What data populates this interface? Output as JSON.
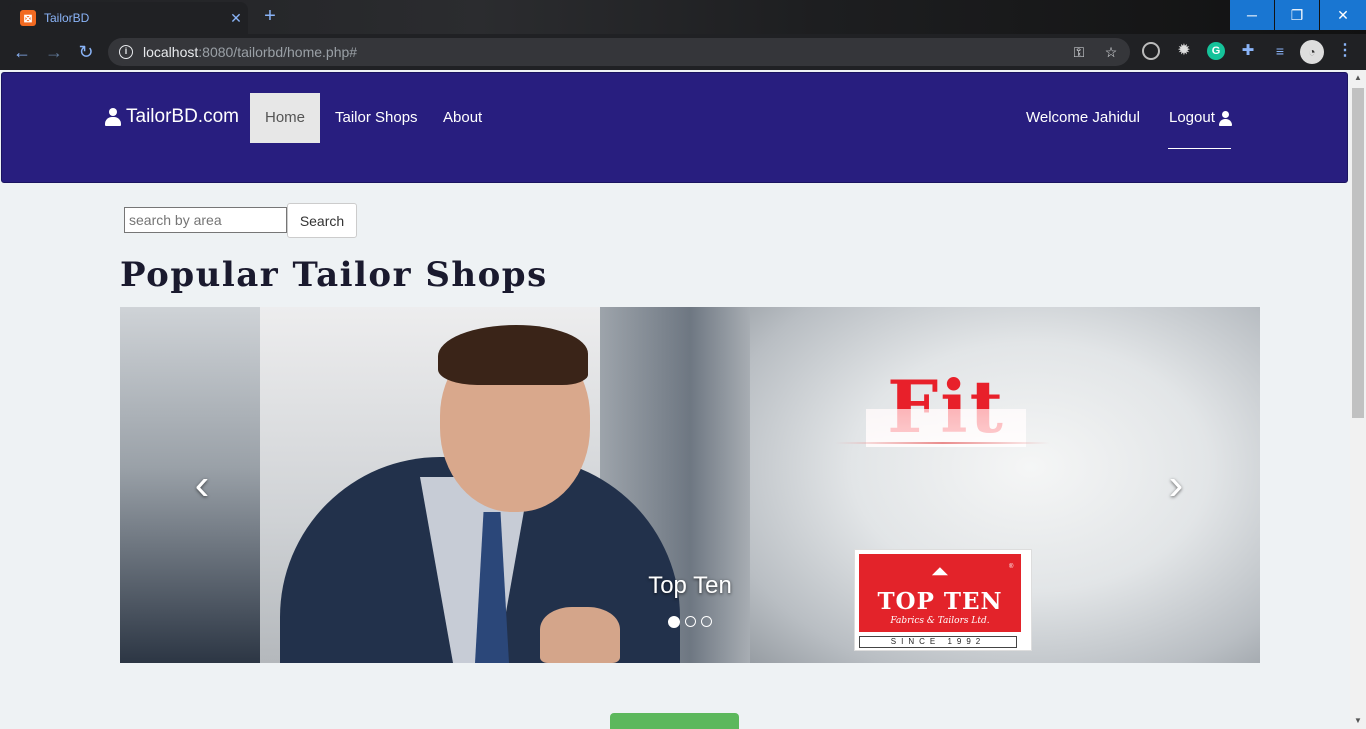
{
  "browser": {
    "tab_title": "TailorBD",
    "favicon": "xampp-icon",
    "url_host": "localhost",
    "url_path": ":8080/tailorbd/home.php#",
    "window_controls": [
      "minimize",
      "restore",
      "close"
    ]
  },
  "navbar": {
    "brand": "TailorBD.com",
    "links": [
      "Home",
      "Tailor Shops",
      "About"
    ],
    "active_link": "Home",
    "welcome": "Welcome Jahidul",
    "logout": "Logout",
    "bg_color": "#281e7f"
  },
  "search": {
    "placeholder": "search by area",
    "button": "Search"
  },
  "main": {
    "section_title": "Popular Tailor Shops"
  },
  "carousel": {
    "caption": "Top Ten",
    "slide_count": 3,
    "active_slide": 1,
    "logos": {
      "fit": "Fit",
      "topten_name": "TOP TEN",
      "topten_sub": "Fabrics & Tailors Ltd.",
      "topten_since": "SINCE 1992",
      "topten_reg": "®"
    }
  },
  "colors": {
    "accent_green": "#5cb85c",
    "logo_red": "#e3232a"
  }
}
